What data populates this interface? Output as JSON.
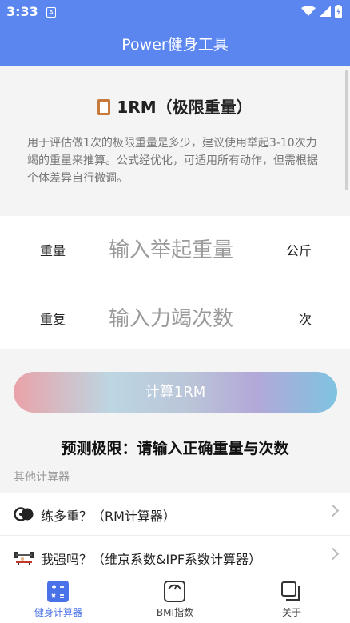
{
  "status_bar": {
    "time": "3:33",
    "notification_letter": "A"
  },
  "app_bar": {
    "title": "Power健身工具"
  },
  "page": {
    "title": "1RM（极限重量）",
    "description": "用于评估做1次的极限重量是多少，建议使用举起3-10次力竭的重量来推算。公式经优化，可适用所有动作，但需根据个体差异自行微调。"
  },
  "form": {
    "weight": {
      "label": "重量",
      "placeholder": "输入举起重量",
      "unit": "公斤"
    },
    "reps": {
      "label": "重复",
      "placeholder": "输入力竭次数",
      "unit": "次"
    }
  },
  "calculate_button": {
    "label": "计算1RM"
  },
  "result": {
    "text": "预测极限：请输入正确重量与次数"
  },
  "other_calculators": {
    "header": "其他计算器",
    "items": [
      {
        "label": "练多重？（RM计算器）",
        "icon": "weight-plates-icon"
      },
      {
        "label": "我强吗？（维京系数&IPF系数计算器）",
        "icon": "bench-press-icon"
      }
    ]
  },
  "bottom_nav": {
    "items": [
      {
        "label": "健身计算器",
        "icon": "calculator-icon",
        "active": true
      },
      {
        "label": "BMI指数",
        "icon": "scale-icon",
        "active": false
      },
      {
        "label": "关于",
        "icon": "about-icon",
        "active": false
      }
    ]
  },
  "colors": {
    "primary": "#5b86f0",
    "active_nav": "#4a72e8"
  }
}
